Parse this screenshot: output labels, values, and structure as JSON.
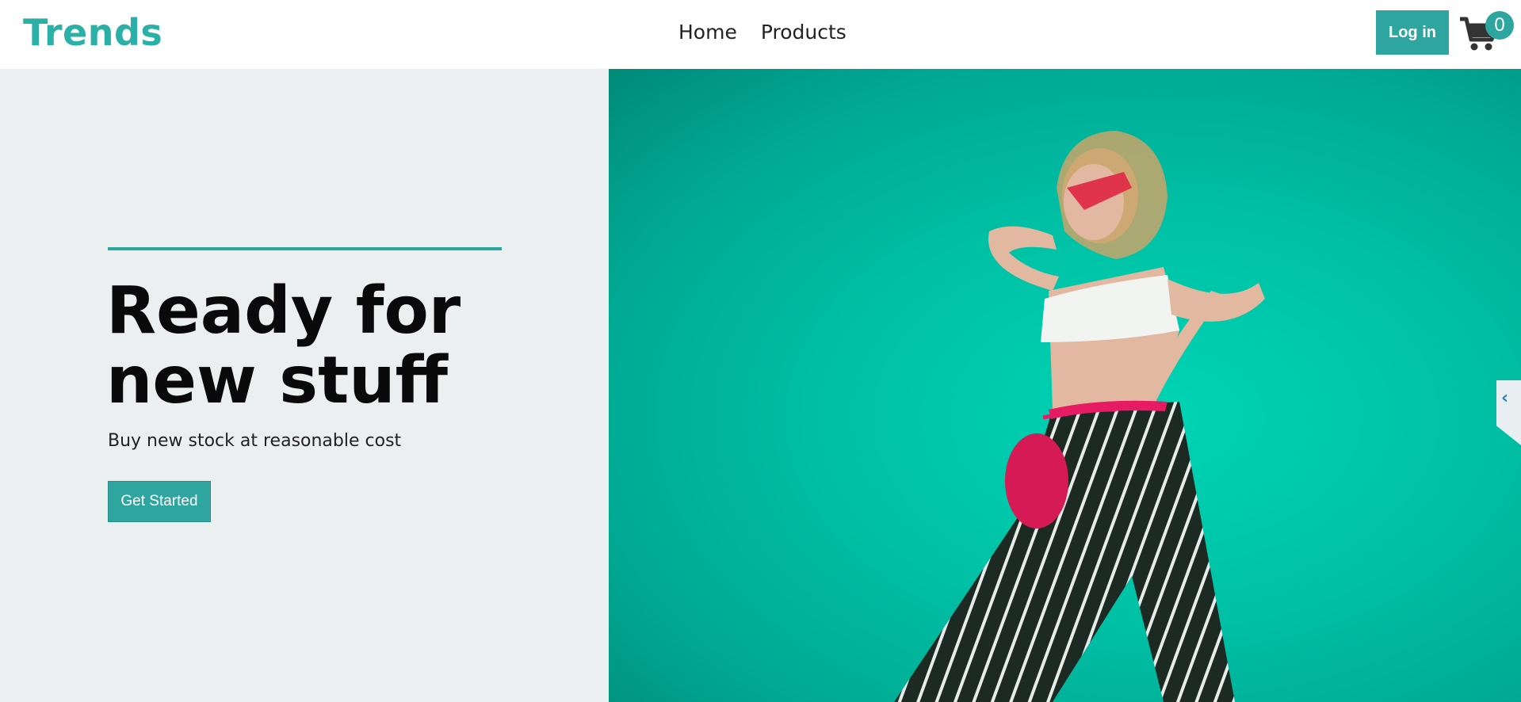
{
  "header": {
    "brand": "Trends",
    "nav": [
      "Home",
      "Products"
    ],
    "login_label": "Log in",
    "cart_count": "0"
  },
  "hero": {
    "title": "Ready for new stuff",
    "subtitle": "Buy new stock at reasonable cost",
    "cta_label": "Get Started"
  },
  "side_tab": {
    "glyph": "‹"
  },
  "icons": {
    "cart": "shopping-cart-icon",
    "side_tab": "chevron-left-icon"
  },
  "colors": {
    "accent": "#2ea69f",
    "hero_left_bg": "#eceff0",
    "hero_image_bg": "#00c1a6"
  }
}
